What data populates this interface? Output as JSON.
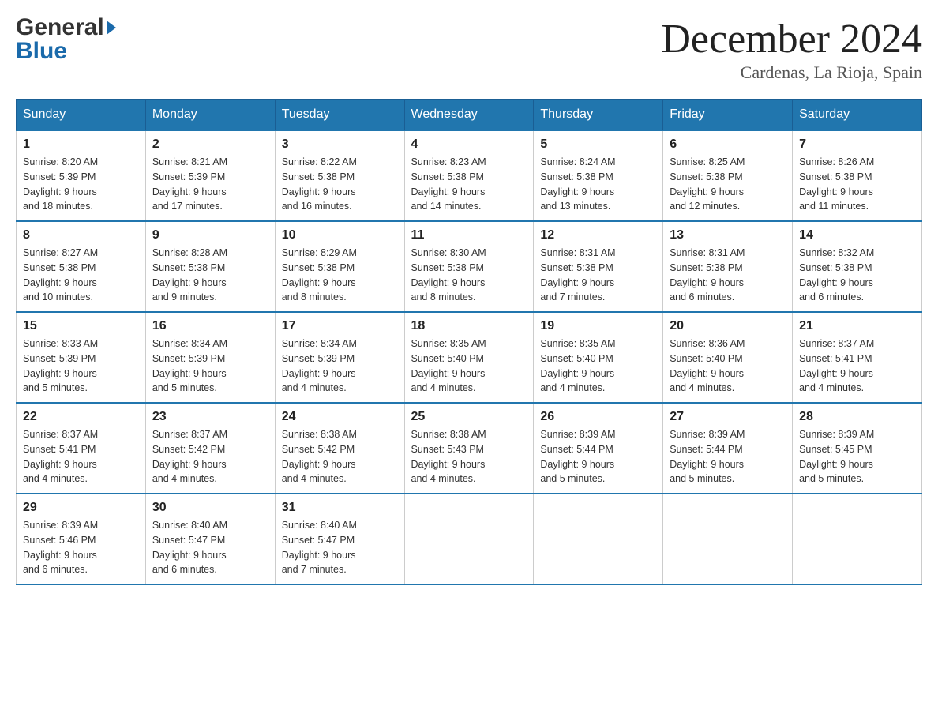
{
  "header": {
    "logo_general": "General",
    "logo_blue": "Blue",
    "month_title": "December 2024",
    "location": "Cardenas, La Rioja, Spain"
  },
  "weekdays": [
    "Sunday",
    "Monday",
    "Tuesday",
    "Wednesday",
    "Thursday",
    "Friday",
    "Saturday"
  ],
  "weeks": [
    [
      {
        "day": "1",
        "sunrise": "8:20 AM",
        "sunset": "5:39 PM",
        "daylight": "9 hours and 18 minutes."
      },
      {
        "day": "2",
        "sunrise": "8:21 AM",
        "sunset": "5:39 PM",
        "daylight": "9 hours and 17 minutes."
      },
      {
        "day": "3",
        "sunrise": "8:22 AM",
        "sunset": "5:38 PM",
        "daylight": "9 hours and 16 minutes."
      },
      {
        "day": "4",
        "sunrise": "8:23 AM",
        "sunset": "5:38 PM",
        "daylight": "9 hours and 14 minutes."
      },
      {
        "day": "5",
        "sunrise": "8:24 AM",
        "sunset": "5:38 PM",
        "daylight": "9 hours and 13 minutes."
      },
      {
        "day": "6",
        "sunrise": "8:25 AM",
        "sunset": "5:38 PM",
        "daylight": "9 hours and 12 minutes."
      },
      {
        "day": "7",
        "sunrise": "8:26 AM",
        "sunset": "5:38 PM",
        "daylight": "9 hours and 11 minutes."
      }
    ],
    [
      {
        "day": "8",
        "sunrise": "8:27 AM",
        "sunset": "5:38 PM",
        "daylight": "9 hours and 10 minutes."
      },
      {
        "day": "9",
        "sunrise": "8:28 AM",
        "sunset": "5:38 PM",
        "daylight": "9 hours and 9 minutes."
      },
      {
        "day": "10",
        "sunrise": "8:29 AM",
        "sunset": "5:38 PM",
        "daylight": "9 hours and 8 minutes."
      },
      {
        "day": "11",
        "sunrise": "8:30 AM",
        "sunset": "5:38 PM",
        "daylight": "9 hours and 8 minutes."
      },
      {
        "day": "12",
        "sunrise": "8:31 AM",
        "sunset": "5:38 PM",
        "daylight": "9 hours and 7 minutes."
      },
      {
        "day": "13",
        "sunrise": "8:31 AM",
        "sunset": "5:38 PM",
        "daylight": "9 hours and 6 minutes."
      },
      {
        "day": "14",
        "sunrise": "8:32 AM",
        "sunset": "5:38 PM",
        "daylight": "9 hours and 6 minutes."
      }
    ],
    [
      {
        "day": "15",
        "sunrise": "8:33 AM",
        "sunset": "5:39 PM",
        "daylight": "9 hours and 5 minutes."
      },
      {
        "day": "16",
        "sunrise": "8:34 AM",
        "sunset": "5:39 PM",
        "daylight": "9 hours and 5 minutes."
      },
      {
        "day": "17",
        "sunrise": "8:34 AM",
        "sunset": "5:39 PM",
        "daylight": "9 hours and 4 minutes."
      },
      {
        "day": "18",
        "sunrise": "8:35 AM",
        "sunset": "5:40 PM",
        "daylight": "9 hours and 4 minutes."
      },
      {
        "day": "19",
        "sunrise": "8:35 AM",
        "sunset": "5:40 PM",
        "daylight": "9 hours and 4 minutes."
      },
      {
        "day": "20",
        "sunrise": "8:36 AM",
        "sunset": "5:40 PM",
        "daylight": "9 hours and 4 minutes."
      },
      {
        "day": "21",
        "sunrise": "8:37 AM",
        "sunset": "5:41 PM",
        "daylight": "9 hours and 4 minutes."
      }
    ],
    [
      {
        "day": "22",
        "sunrise": "8:37 AM",
        "sunset": "5:41 PM",
        "daylight": "9 hours and 4 minutes."
      },
      {
        "day": "23",
        "sunrise": "8:37 AM",
        "sunset": "5:42 PM",
        "daylight": "9 hours and 4 minutes."
      },
      {
        "day": "24",
        "sunrise": "8:38 AM",
        "sunset": "5:42 PM",
        "daylight": "9 hours and 4 minutes."
      },
      {
        "day": "25",
        "sunrise": "8:38 AM",
        "sunset": "5:43 PM",
        "daylight": "9 hours and 4 minutes."
      },
      {
        "day": "26",
        "sunrise": "8:39 AM",
        "sunset": "5:44 PM",
        "daylight": "9 hours and 5 minutes."
      },
      {
        "day": "27",
        "sunrise": "8:39 AM",
        "sunset": "5:44 PM",
        "daylight": "9 hours and 5 minutes."
      },
      {
        "day": "28",
        "sunrise": "8:39 AM",
        "sunset": "5:45 PM",
        "daylight": "9 hours and 5 minutes."
      }
    ],
    [
      {
        "day": "29",
        "sunrise": "8:39 AM",
        "sunset": "5:46 PM",
        "daylight": "9 hours and 6 minutes."
      },
      {
        "day": "30",
        "sunrise": "8:40 AM",
        "sunset": "5:47 PM",
        "daylight": "9 hours and 6 minutes."
      },
      {
        "day": "31",
        "sunrise": "8:40 AM",
        "sunset": "5:47 PM",
        "daylight": "9 hours and 7 minutes."
      },
      null,
      null,
      null,
      null
    ]
  ],
  "labels": {
    "sunrise": "Sunrise:",
    "sunset": "Sunset:",
    "daylight": "Daylight:"
  }
}
